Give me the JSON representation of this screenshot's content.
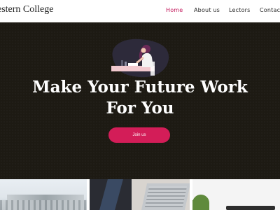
{
  "header": {
    "brand": "estern College",
    "nav": [
      {
        "label": "Home",
        "active": true
      },
      {
        "label": "About us",
        "active": false
      },
      {
        "label": "Lectors",
        "active": false
      },
      {
        "label": "Contact",
        "active": false
      }
    ]
  },
  "hero": {
    "title_line1": "Make Your Future Work",
    "title_line2": "For You",
    "cta_label": "Join us"
  },
  "colors": {
    "accent": "#d31d58",
    "nav_active": "#c2185b",
    "hero_bg": "#1d1a13"
  }
}
